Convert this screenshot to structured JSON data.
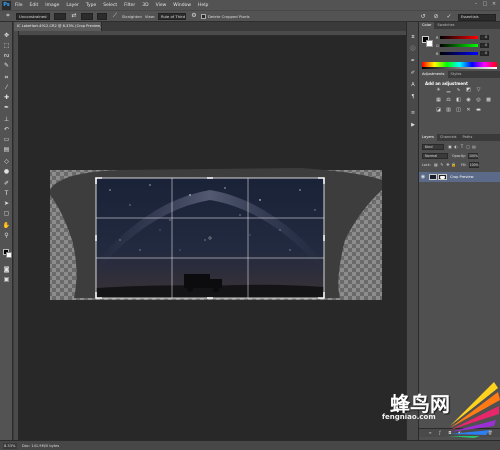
{
  "app": {
    "logo": "Ps"
  },
  "menubar": {
    "items": [
      "File",
      "Edit",
      "Image",
      "Layer",
      "Type",
      "Select",
      "Filter",
      "3D",
      "View",
      "Window",
      "Help"
    ],
    "window_controls": [
      "–",
      "□",
      "×"
    ]
  },
  "options": {
    "preset": "Unconstrained",
    "straighten_label": "Straighten",
    "view_label": "View:",
    "view_value": "Rule of Thirds",
    "delete_cropped_label": "Delete Cropped Pixels",
    "workspace": "Essentials"
  },
  "document": {
    "tab_title": "IC LakeHart-4912.CR2 @ 8.33% (Crop Preview, RGB/8*) *"
  },
  "status": {
    "zoom": "8.33%",
    "doc_info": "Doc: 141.9M/0 bytes"
  },
  "panels": {
    "color_tabs": [
      "Color",
      "Swatches"
    ],
    "sliders": [
      {
        "letter": "R",
        "value": "0"
      },
      {
        "letter": "G",
        "value": "0"
      },
      {
        "letter": "B",
        "value": "0"
      }
    ],
    "adjustment_tabs": [
      "Adjustments",
      "Styles"
    ],
    "adjustment_heading": "Add an adjustment",
    "layers_tabs": [
      "Layers",
      "Channels",
      "Paths"
    ],
    "kind_label": "Kind",
    "blend_mode": "Normal",
    "opacity_label": "Opacity:",
    "opacity_value": "100%",
    "lock_label": "Lock:",
    "fill_label": "Fill:",
    "fill_value": "100%",
    "layer_name": "Crop Preview"
  },
  "watermark": {
    "title": "蜂鸟网",
    "url": "fengniao.com",
    "colors": [
      "#ffd21f",
      "#ff7a14",
      "#e8266b",
      "#9b2fd6",
      "#2d7ef0",
      "#29c46b"
    ]
  },
  "canvas": {
    "checker_dark": "#6a6a6a",
    "checker_light": "#9a9a9a",
    "mask_color": "#3b3b3b",
    "photo_colors": [
      "#121a2e",
      "#1d2744",
      "#2a2a3a",
      "#0b0b10"
    ]
  }
}
